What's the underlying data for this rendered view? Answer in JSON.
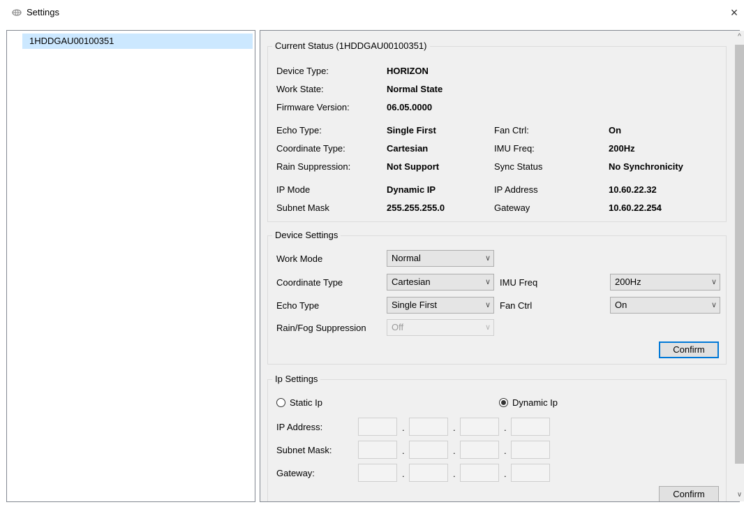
{
  "window": {
    "title": "Settings",
    "close_glyph": "×"
  },
  "device_list": {
    "items": [
      {
        "label": "1HDDGAU00100351",
        "selected": true
      }
    ]
  },
  "current_status": {
    "title": "Current Status (1HDDGAU00100351)",
    "rows": [
      {
        "label": "Device Type:",
        "value": "HORIZON"
      },
      {
        "label": "Work State:",
        "value": "Normal State"
      },
      {
        "label": "Firmware Version:",
        "value": "06.05.0000"
      },
      {
        "label": "Echo Type:",
        "value": "Single First",
        "label2": "Fan Ctrl:",
        "value2": "On"
      },
      {
        "label": "Coordinate Type:",
        "value": "Cartesian",
        "label2": "IMU Freq:",
        "value2": "200Hz"
      },
      {
        "label": "Rain Suppression:",
        "value": "Not Support",
        "label2": "Sync Status",
        "value2": "No Synchronicity"
      },
      {
        "label": "IP Mode",
        "value": "Dynamic IP",
        "label2": "IP Address",
        "value2": "10.60.22.32"
      },
      {
        "label": "Subnet Mask",
        "value": "255.255.255.0",
        "label2": "Gateway",
        "value2": "10.60.22.254"
      }
    ]
  },
  "device_settings": {
    "title": "Device Settings",
    "work_mode": {
      "label": "Work Mode",
      "value": "Normal"
    },
    "coordinate_type": {
      "label": "Coordinate Type",
      "value": "Cartesian"
    },
    "imu_freq": {
      "label": "IMU Freq",
      "value": "200Hz"
    },
    "echo_type": {
      "label": "Echo Type",
      "value": "Single First"
    },
    "fan_ctrl": {
      "label": "Fan Ctrl",
      "value": "On"
    },
    "rain_fog": {
      "label": "Rain/Fog Suppression",
      "value": "Off",
      "disabled": true
    },
    "confirm_label": "Confirm",
    "dropdown_glyph": "∨"
  },
  "ip_settings": {
    "title": "Ip Settings",
    "static_label": "Static Ip",
    "dynamic_label": "Dynamic Ip",
    "selected_mode": "dynamic",
    "ip_address_label": "IP Address:",
    "subnet_mask_label": "Subnet Mask:",
    "gateway_label": "Gateway:",
    "dot": ".",
    "confirm_label": "Confirm"
  },
  "scrollbar": {
    "up_glyph": "^",
    "down_glyph": "∨"
  }
}
